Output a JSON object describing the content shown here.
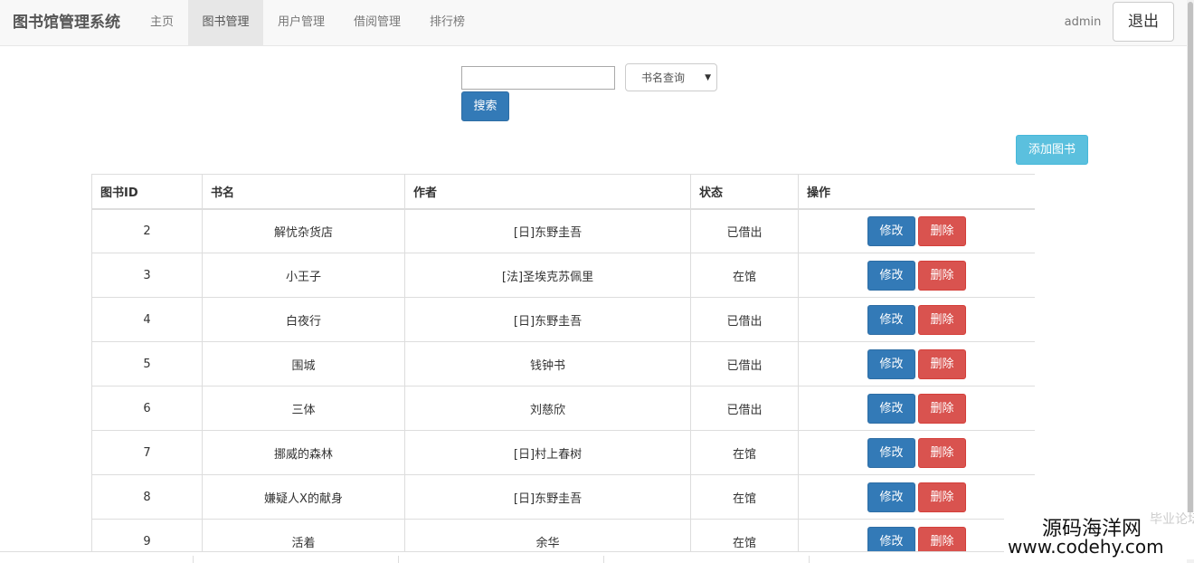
{
  "navbar": {
    "brand": "图书馆管理系统",
    "items": [
      {
        "label": "主页",
        "active": false
      },
      {
        "label": "图书管理",
        "active": true
      },
      {
        "label": "用户管理",
        "active": false
      },
      {
        "label": "借阅管理",
        "active": false
      },
      {
        "label": "排行榜",
        "active": false
      }
    ],
    "user": "admin",
    "logout_label": "退出"
  },
  "search": {
    "input_value": "",
    "select_value": "书名查询",
    "button_label": "搜索"
  },
  "add_button_label": "添加图书",
  "table": {
    "headers": [
      "图书ID",
      "书名",
      "作者",
      "状态",
      "操作"
    ],
    "edit_label": "修改",
    "delete_label": "删除",
    "rows": [
      {
        "id": "2",
        "title": "解忧杂货店",
        "author": "[日]东野圭吾",
        "status": "已借出"
      },
      {
        "id": "3",
        "title": "小王子",
        "author": "[法]圣埃克苏佩里",
        "status": "在馆"
      },
      {
        "id": "4",
        "title": "白夜行",
        "author": "[日]东野圭吾",
        "status": "已借出"
      },
      {
        "id": "5",
        "title": "围城",
        "author": "钱钟书",
        "status": "已借出"
      },
      {
        "id": "6",
        "title": "三体",
        "author": "刘慈欣",
        "status": "已借出"
      },
      {
        "id": "7",
        "title": "挪威的森林",
        "author": "[日]村上春树",
        "status": "在馆"
      },
      {
        "id": "8",
        "title": "嫌疑人X的献身",
        "author": "[日]东野圭吾",
        "status": "在馆"
      },
      {
        "id": "9",
        "title": "活着",
        "author": "余华",
        "status": "在馆"
      }
    ]
  },
  "watermark": {
    "title": "源码海洋网",
    "url": "www.codehy.com",
    "faint": "毕业论坛"
  },
  "colors": {
    "primary": "#337ab7",
    "danger": "#d9534f",
    "info": "#5bc0de",
    "navbar_bg": "#f8f8f8"
  }
}
